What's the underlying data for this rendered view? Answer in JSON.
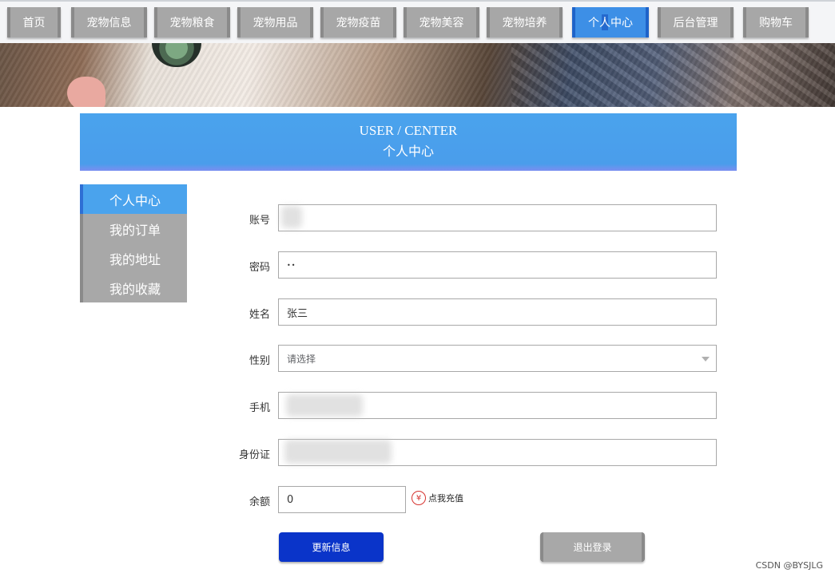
{
  "nav": {
    "items": [
      "首页",
      "宠物信息",
      "宠物粮食",
      "宠物用品",
      "宠物疫苗",
      "宠物美容",
      "宠物培养",
      "个人中心",
      "后台管理",
      "购物车"
    ],
    "active_index": 7
  },
  "header": {
    "title_en": "USER / CENTER",
    "title_cn": "个人中心"
  },
  "sidebar": {
    "items": [
      "个人中心",
      "我的订单",
      "我的地址",
      "我的收藏"
    ],
    "active_index": 0
  },
  "form": {
    "account_label": "账号",
    "account_value": "",
    "password_label": "密码",
    "password_value": "••",
    "name_label": "姓名",
    "name_value": "张三",
    "gender_label": "性别",
    "gender_placeholder": "请选择",
    "phone_label": "手机",
    "phone_value": "",
    "idcard_label": "身份证",
    "idcard_value": "",
    "balance_label": "余额",
    "balance_value": "0",
    "recharge_icon": "¥",
    "recharge_link": "点我充值"
  },
  "buttons": {
    "update": "更新信息",
    "logout": "退出登录"
  },
  "watermark": "CSDN @BYSJLG",
  "colors": {
    "primary": "#4aa3ed",
    "button_blue": "#0a34c9",
    "gray": "#a8a8a8"
  }
}
